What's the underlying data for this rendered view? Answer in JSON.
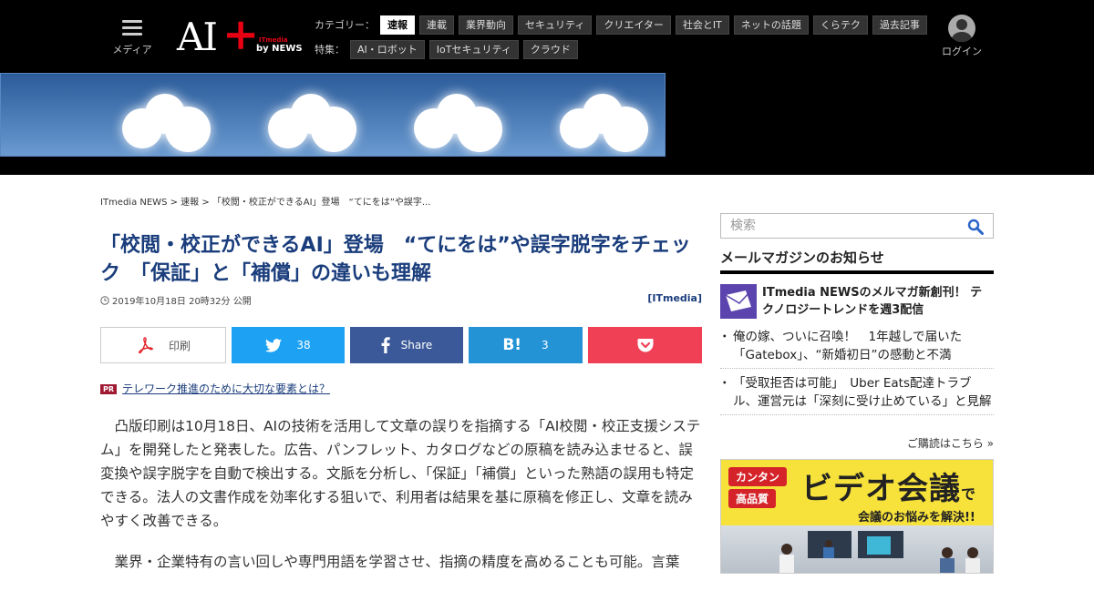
{
  "header": {
    "menu_label": "メディア",
    "logo": {
      "ai": "AI",
      "plus": "+",
      "brand_small": "ITmedia",
      "by": "by NEWS"
    },
    "category_head": "カテゴリー：",
    "categories": [
      "速報",
      "連載",
      "業界動向",
      "セキュリティ",
      "クリエイター",
      "社会とIT",
      "ネットの話題",
      "くらテク",
      "過去記事"
    ],
    "feature_head": "特集：",
    "features": [
      "AI・ロボット",
      "IoTセキュリティ",
      "クラウド"
    ],
    "login_label": "ログイン"
  },
  "breadcrumb": [
    "ITmedia NEWS",
    " > ",
    "速報",
    " > ",
    "「校閲・校正ができるAI」登場　“てにをは”や誤字..."
  ],
  "article": {
    "title": "「校閲・校正ができるAI」登場　“てにをは”や誤字脱字をチェック　「保証」と「補償」の違いも理解",
    "date": "2019年10月18日 20時32分 公開",
    "source": "[ITmedia]",
    "share": {
      "print": "印刷",
      "twitter": "38",
      "facebook": "Share",
      "hatena": "3"
    },
    "pr_badge": "PR",
    "pr_link": "テレワーク推進のために大切な要素とは？",
    "paragraphs": [
      "凸版印刷は10月18日、AIの技術を活用して文章の誤りを指摘する「AI校閲・校正支援システム」を開発したと発表した。広告、パンフレット、カタログなどの原稿を読み込ませると、誤変換や誤字脱字を自動で検出する。文脈を分析し、「保証」「補償」といった熟語の誤用も特定できる。法人の文書作成を効率化する狙いで、利用者は結果を基に原稿を修正し、文章を読みやすく改善できる。",
      "業界・企業特有の言い回しや専門用語を学習させ、指摘の精度を高めることも可能。言葉"
    ]
  },
  "sidebar": {
    "search_placeholder": "検索",
    "mm_heading": "メールマガジンのお知らせ",
    "mm_feature": "ITmedia NEWSのメルマガ新創刊！ テクノロジートレンドを週3配信",
    "mm_items": [
      "俺の嫁、ついに召喚！　1年越しで届いた「Gatebox」、“新婚初日”の感動と不満",
      "「受取拒否は可能」　Uber Eats配達トラブル、運営元は「深刻に受け止めている」と見解"
    ],
    "mm_more": "ご購読はこちら »",
    "ad": {
      "badge1": "カンタン",
      "badge2": "高品質",
      "headline": "ビデオ会議",
      "headline_suffix": "で",
      "sub": "会議のお悩みを解決!!"
    }
  },
  "colors": {
    "title": "#1a3d7c",
    "twitter": "#1da1f2",
    "facebook": "#3b5998",
    "hatena": "#2493d6",
    "pocket": "#ef4056",
    "ad_bg": "#f7e23b"
  }
}
